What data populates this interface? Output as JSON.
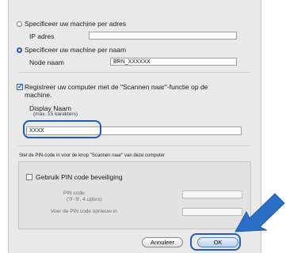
{
  "radio_address": {
    "label": "Specificeer uw machine per adres",
    "selected": false
  },
  "ip": {
    "label": "IP adres",
    "value": ""
  },
  "radio_name": {
    "label": "Specificeer uw machine per naam",
    "selected": true
  },
  "node": {
    "label": "Node naam",
    "value": "BRN_XXXXXX"
  },
  "register": {
    "line1": "Registreer uw computer met de \"Scannen naar\"-functie op de",
    "line2": "machine.",
    "checked": true
  },
  "display": {
    "label": "Display Naam",
    "hint": "(max. 15 karakters)",
    "value": "XXXX"
  },
  "pin_section": {
    "title": "Stel de PIN-code in voor de knop \"Scannen naar\" van deze computer",
    "use_pin_label": "Gebruik PIN code beveiliging",
    "use_pin_checked": false,
    "pin_label": "PIN code",
    "pin_hint": "('0'-'9', 4 cijfers)",
    "pin_value": "",
    "pin_repeat_label": "Voer de PIN code opnieuw in",
    "pin_repeat_value": ""
  },
  "buttons": {
    "cancel": "Annuleer",
    "ok": "OK"
  },
  "colors": {
    "highlight": "#1e5db3",
    "arrow": "#2b6ec6"
  }
}
